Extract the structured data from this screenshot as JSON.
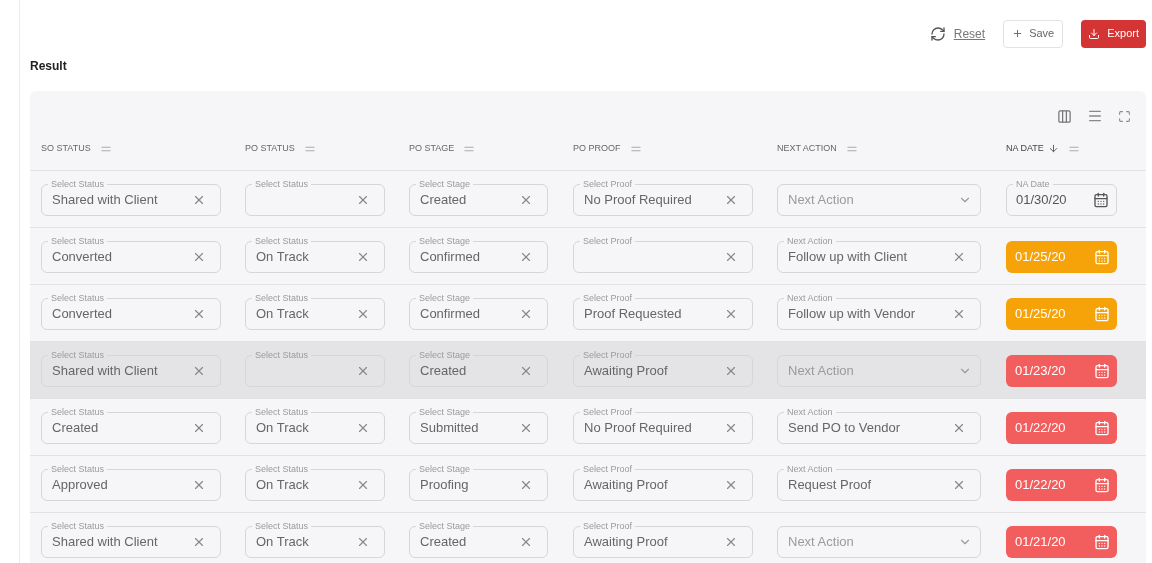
{
  "toolbar": {
    "reset": "Reset",
    "save": "Save",
    "export": "Export"
  },
  "section_title": "Result",
  "columns": [
    {
      "label": "SO STATUS",
      "sorted": false
    },
    {
      "label": "PO STATUS",
      "sorted": false
    },
    {
      "label": "PO STAGE",
      "sorted": false
    },
    {
      "label": "PO PROOF",
      "sorted": false
    },
    {
      "label": "NEXT ACTION",
      "sorted": false
    },
    {
      "label": "NA DATE",
      "sorted": true
    }
  ],
  "rows": [
    {
      "highlighted": false,
      "cells": [
        {
          "kind": "select",
          "label": "Select Status",
          "value": "Shared with Client"
        },
        {
          "kind": "select",
          "label": "Select Status"
        },
        {
          "kind": "select",
          "label": "Select Stage",
          "value": "Created"
        },
        {
          "kind": "select",
          "label": "Select Proof",
          "value": "No Proof Required"
        },
        {
          "kind": "dropdown",
          "placeholder": "Next Action"
        },
        {
          "kind": "date",
          "label": "NA Date",
          "value": "01/30/20"
        }
      ]
    },
    {
      "highlighted": false,
      "cells": [
        {
          "kind": "select",
          "label": "Select Status",
          "value": "Converted"
        },
        {
          "kind": "select",
          "label": "Select Status",
          "value": "On Track"
        },
        {
          "kind": "select",
          "label": "Select Stage",
          "value": "Confirmed"
        },
        {
          "kind": "select",
          "label": "Select Proof"
        },
        {
          "kind": "select",
          "label": "Next Action",
          "value": "Follow up with Client"
        },
        {
          "kind": "date",
          "value": "01/25/20",
          "color": "#f6a209"
        }
      ]
    },
    {
      "highlighted": false,
      "cells": [
        {
          "kind": "select",
          "label": "Select Status",
          "value": "Converted"
        },
        {
          "kind": "select",
          "label": "Select Status",
          "value": "On Track"
        },
        {
          "kind": "select",
          "label": "Select Stage",
          "value": "Confirmed"
        },
        {
          "kind": "select",
          "label": "Select Proof",
          "value": "Proof Requested"
        },
        {
          "kind": "select",
          "label": "Next Action",
          "value": "Follow up with Vendor"
        },
        {
          "kind": "date",
          "value": "01/25/20",
          "color": "#f6a209"
        }
      ]
    },
    {
      "highlighted": true,
      "cells": [
        {
          "kind": "select",
          "label": "Select Status",
          "value": "Shared with Client"
        },
        {
          "kind": "select",
          "label": "Select Status"
        },
        {
          "kind": "select",
          "label": "Select Stage",
          "value": "Created"
        },
        {
          "kind": "select",
          "label": "Select Proof",
          "value": "Awaiting Proof"
        },
        {
          "kind": "dropdown",
          "placeholder": "Next Action"
        },
        {
          "kind": "date",
          "value": "01/23/20",
          "color": "#f25d5d"
        }
      ]
    },
    {
      "highlighted": false,
      "cells": [
        {
          "kind": "select",
          "label": "Select Status",
          "value": "Created"
        },
        {
          "kind": "select",
          "label": "Select Status",
          "value": "On Track"
        },
        {
          "kind": "select",
          "label": "Select Stage",
          "value": "Submitted"
        },
        {
          "kind": "select",
          "label": "Select Proof",
          "value": "No Proof Required"
        },
        {
          "kind": "select",
          "label": "Next Action",
          "value": "Send PO to Vendor"
        },
        {
          "kind": "date",
          "value": "01/22/20",
          "color": "#f25d5d"
        }
      ]
    },
    {
      "highlighted": false,
      "cells": [
        {
          "kind": "select",
          "label": "Select Status",
          "value": "Approved"
        },
        {
          "kind": "select",
          "label": "Select Status",
          "value": "On Track"
        },
        {
          "kind": "select",
          "label": "Select Stage",
          "value": "Proofing"
        },
        {
          "kind": "select",
          "label": "Select Proof",
          "value": "Awaiting Proof"
        },
        {
          "kind": "select",
          "label": "Next Action",
          "value": "Request Proof"
        },
        {
          "kind": "date",
          "value": "01/22/20",
          "color": "#f25d5d"
        }
      ]
    },
    {
      "highlighted": false,
      "cells": [
        {
          "kind": "select",
          "label": "Select Status",
          "value": "Shared with Client"
        },
        {
          "kind": "select",
          "label": "Select Status",
          "value": "On Track"
        },
        {
          "kind": "select",
          "label": "Select Stage",
          "value": "Created"
        },
        {
          "kind": "select",
          "label": "Select Proof",
          "value": "Awaiting Proof"
        },
        {
          "kind": "dropdown",
          "placeholder": "Next Action"
        },
        {
          "kind": "date",
          "value": "01/21/20",
          "color": "#f25d5d"
        }
      ]
    }
  ]
}
